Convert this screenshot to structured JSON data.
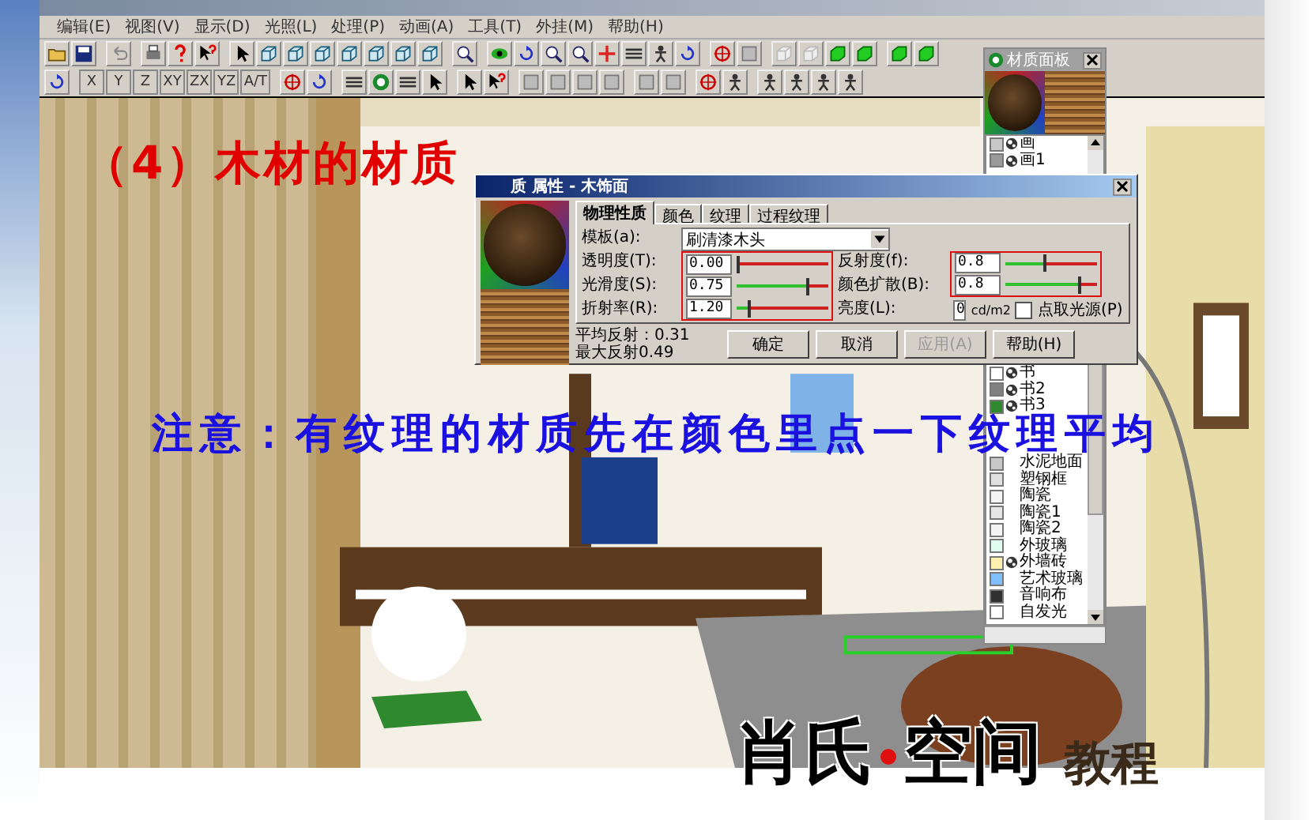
{
  "menu": [
    "编辑(E)",
    "视图(V)",
    "显示(D)",
    "光照(L)",
    "处理(P)",
    "动画(A)",
    "工具(T)",
    "外挂(M)",
    "帮助(H)"
  ],
  "axis_buttons": [
    "X",
    "Y",
    "Z",
    "XY",
    "ZX",
    "YZ",
    "A/T"
  ],
  "heading": "（4）木材的材质",
  "note": "注意：有纹理的材质先在颜色里点一下纹理平均",
  "material_panel": {
    "title": "材质面板",
    "runs": [
      [
        {
          "name": "画",
          "color": "#c8c8c8",
          "textured": true
        },
        {
          "name": "画1",
          "color": "#9a9a9a",
          "textured": true
        }
      ],
      [
        {
          "name": "书",
          "color": "#ffffff",
          "textured": true
        },
        {
          "name": "书2",
          "color": "#808080",
          "textured": true
        },
        {
          "name": "书3",
          "color": "#2f8a2f",
          "textured": true
        }
      ],
      [
        {
          "name": "水泥地面",
          "color": "#c8c8c8",
          "textured": false
        },
        {
          "name": "塑钢框",
          "color": "#e0e0e0",
          "textured": false
        },
        {
          "name": "陶瓷",
          "color": "#f4f4f4",
          "textured": false
        },
        {
          "name": "陶瓷1",
          "color": "#e6e6e6",
          "textured": false
        },
        {
          "name": "陶瓷2",
          "color": "#f4f4f4",
          "textured": false
        },
        {
          "name": "外玻璃",
          "color": "#e0fff0",
          "textured": false
        },
        {
          "name": "外墙砖",
          "color": "#fff0b0",
          "textured": true
        },
        {
          "name": "艺术玻璃",
          "color": "#80c0ff",
          "textured": false
        },
        {
          "name": "音响布",
          "color": "#303030",
          "textured": false
        },
        {
          "name": "自发光",
          "color": "#ffffff",
          "textured": false
        }
      ]
    ]
  },
  "dialog": {
    "title": "质 属性 - 木饰面",
    "tabs": [
      {
        "label": "物理性质",
        "selected": true
      },
      {
        "label": "颜色",
        "selected": false
      },
      {
        "label": "纹理",
        "selected": false
      },
      {
        "label": "过程纹理",
        "selected": false
      }
    ],
    "template": {
      "label": "模板(a):",
      "value": "刷清漆木头"
    },
    "left_sliders": [
      {
        "label": "透明度(T):",
        "value": "0.00",
        "level": 0.0
      },
      {
        "label": "光滑度(S):",
        "value": "0.75",
        "level": 0.75
      },
      {
        "label": "折射率(R):",
        "value": "1.20",
        "level": 0.12
      }
    ],
    "right_sliders": [
      {
        "label": "反射度(f):",
        "value": "0.8",
        "level": 0.42
      },
      {
        "label": "颜色扩散(B):",
        "value": "0.8",
        "level": 0.8
      }
    ],
    "brightness": {
      "label": "亮度(L):",
      "value": "0",
      "unit": "cd/m2",
      "checkbox": {
        "label": "点取光源(P)",
        "checked": false
      }
    },
    "stats": [
      "平均反射：0.31",
      "最大反射0.49"
    ],
    "buttons": [
      {
        "label": "确定",
        "disabled": false
      },
      {
        "label": "取消",
        "disabled": false
      },
      {
        "label": "应用(A)",
        "disabled": true
      },
      {
        "label": "帮助(H)",
        "disabled": false
      }
    ]
  },
  "logo": {
    "brand_left": "肖氏",
    "brand_right": "空间",
    "suffix": "教程"
  }
}
